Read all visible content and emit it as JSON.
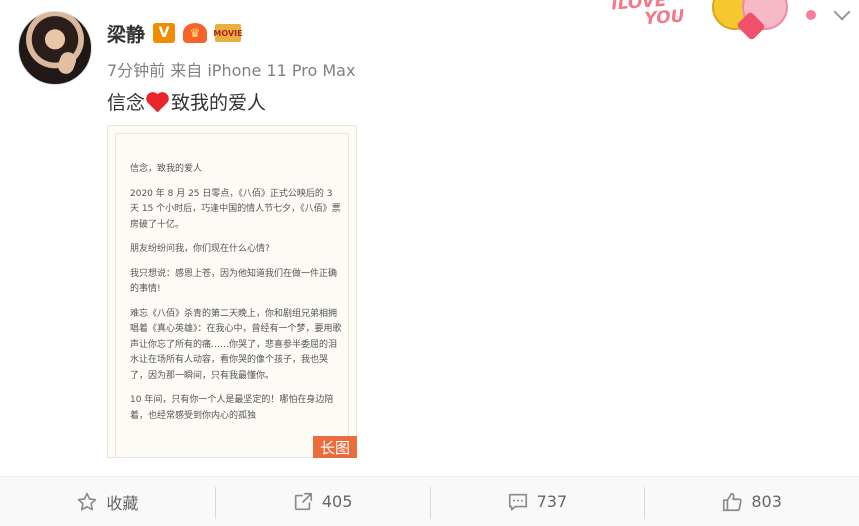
{
  "user": {
    "name": "梁静",
    "badge_v": "V",
    "badge_movie": "MOVIE"
  },
  "meta": "7分钟前 来自 iPhone 11 Pro Max",
  "post": {
    "text_before": "信念",
    "text_after": "致我的爱人"
  },
  "decoration": {
    "love": "LOVE",
    "you": "YOU",
    "love_prefix": "I"
  },
  "long_image": {
    "paragraphs": [
      "信念，致我的爱人",
      "2020 年 8 月 25 日零点，《八佰》正式公映后的 3 天 15 个小时后，巧逢中国的情人节七夕，《八佰》票房破了十亿。",
      "朋友纷纷问我，你们现在什么心情?",
      "我只想说：感恩上苍，因为他知道我们在做一件正确的事情!",
      "难忘《八佰》杀青的第二天晚上，你和剧组兄弟相拥唱着《真心英雄》：在我心中，曾经有一个梦，要用歌声让你忘了所有的痛……你哭了，悲喜参半委屈的泪水让在场所有人动容，看你哭的像个孩子，我也哭了，因为那一瞬间，只有我最懂你。",
      "10 年间，只有你一个人是最坚定的！哪怕在身边陪着，也经常感受到你内心的孤独"
    ],
    "badge": "长图"
  },
  "actions": {
    "collect": "收藏",
    "repost": "405",
    "comment": "737",
    "like": "803"
  }
}
